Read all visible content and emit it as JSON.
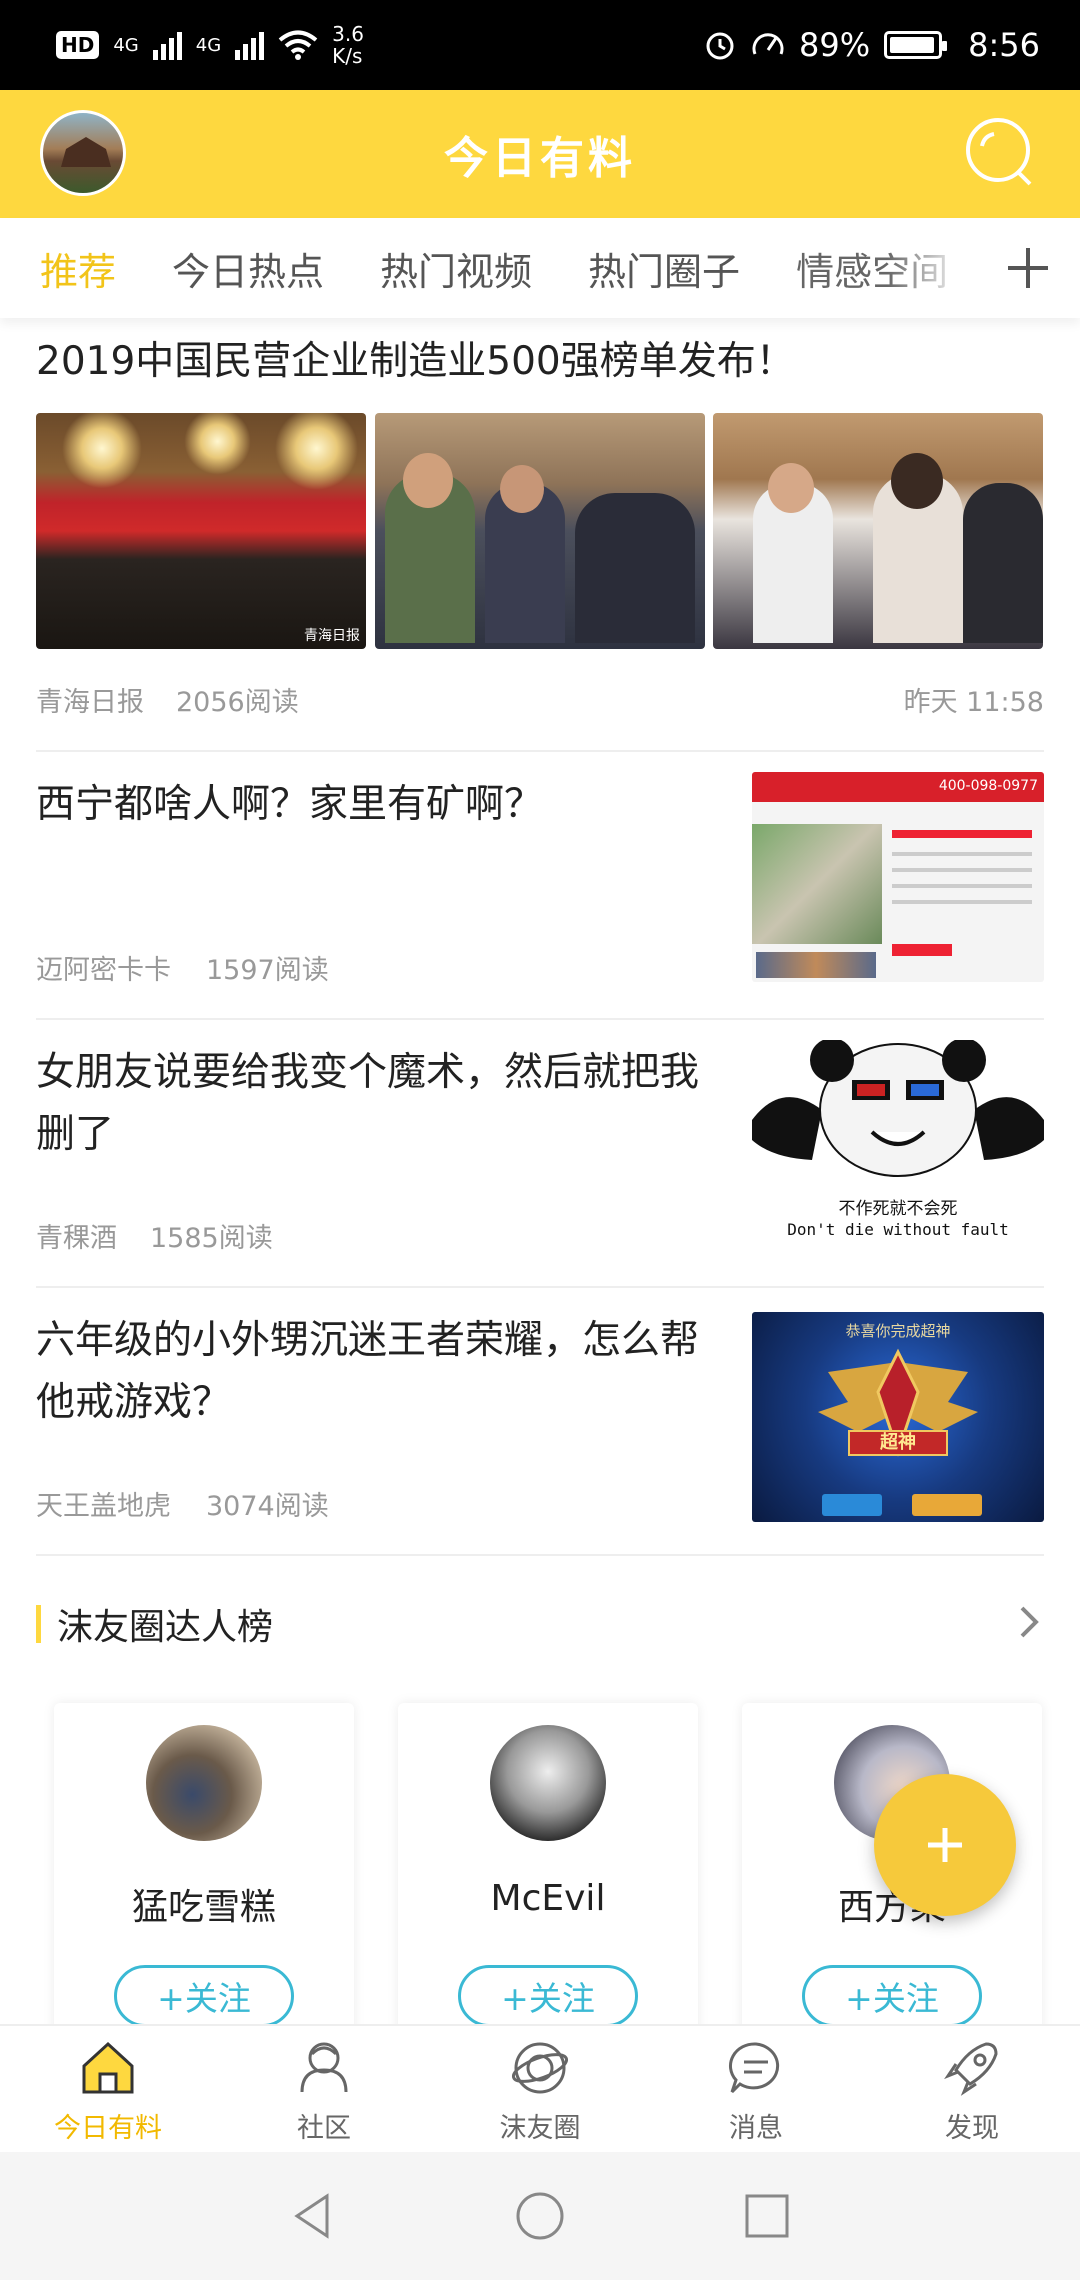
{
  "status": {
    "hd": "HD",
    "sim1": "4G",
    "sim2": "4G",
    "speed_value": "3.6",
    "speed_unit": "K/s",
    "battery": "89%",
    "time": "8:56"
  },
  "header": {
    "title": "今日有料"
  },
  "tabs": [
    "推荐",
    "今日热点",
    "热门视频",
    "热门圈子",
    "情感空间"
  ],
  "articles": [
    {
      "title": "2019中国民营企业制造业500强榜单发布！",
      "source": "青海日报",
      "reads": "2056阅读",
      "time": "昨天 11:58",
      "img_tag": "青海日报"
    },
    {
      "title": "西宁都啥人啊？家里有矿啊？",
      "source": "迈阿密卡卡",
      "reads": "1597阅读",
      "thumb_phone": "400-098-0977"
    },
    {
      "title": "女朋友说要给我变个魔术，然后就把我删了",
      "source": "青稞酒",
      "reads": "1585阅读",
      "meme_cn": "不作死就不会死",
      "meme_en": "Don't die without fault"
    },
    {
      "title": "六年级的小外甥沉迷王者荣耀，怎么帮他戒游戏？",
      "source": "天王盖地虎",
      "reads": "3074阅读",
      "game_banner": "恭喜你完成超神",
      "game_badge": "超神"
    }
  ],
  "section": {
    "title": "沫友圈达人榜"
  },
  "users": [
    {
      "name": "猛吃雪糕",
      "follow": "+关注"
    },
    {
      "name": "McEvil",
      "follow": "+关注"
    },
    {
      "name": "西方菜",
      "follow": "+关注"
    }
  ],
  "bottom_nav": [
    {
      "label": "今日有料",
      "icon": "home-icon"
    },
    {
      "label": "社区",
      "icon": "community-icon"
    },
    {
      "label": "沫友圈",
      "icon": "planet-icon"
    },
    {
      "label": "消息",
      "icon": "message-icon"
    },
    {
      "label": "发现",
      "icon": "rocket-icon"
    }
  ],
  "colors": {
    "accent": "#fed83f",
    "active_tab": "#f2c419",
    "follow": "#3ab9d4"
  }
}
